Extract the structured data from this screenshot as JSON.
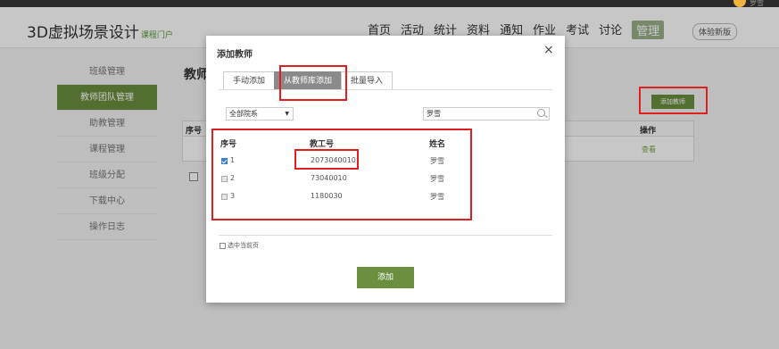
{
  "topbar": {
    "user_name": "罗雪"
  },
  "header": {
    "brand": "3D虚拟场景设计",
    "brand_sub": "课程门户",
    "nav": [
      "首页",
      "活动",
      "统计",
      "资料",
      "通知",
      "作业",
      "考试",
      "讨论",
      "管理"
    ],
    "active_nav": "管理",
    "trial_label": "体验新版"
  },
  "sidebar": {
    "items": [
      {
        "label": "班级管理",
        "active": false
      },
      {
        "label": "教师团队管理",
        "active": true
      },
      {
        "label": "助教管理",
        "active": false
      },
      {
        "label": "课程管理",
        "active": false
      },
      {
        "label": "班级分配",
        "active": false
      },
      {
        "label": "下载中心",
        "active": false
      },
      {
        "label": "操作日志",
        "active": false
      }
    ]
  },
  "background": {
    "title": "教师",
    "add_teacher": "添加教师",
    "col_seq": "序号",
    "col_op": "操作",
    "view_link": "查看"
  },
  "modal": {
    "title": "添加教师",
    "close": "×",
    "tabs": [
      "手动添加",
      "从教师库添加",
      "批量导入"
    ],
    "active_tab": 1,
    "dept_select": "全部院系",
    "search_value": "罗雪",
    "columns": {
      "seq": "序号",
      "id": "教工号",
      "name": "姓名"
    },
    "rows": [
      {
        "seq": "1",
        "id": "2073040010",
        "name": "罗雪",
        "checked": true
      },
      {
        "seq": "2",
        "id": "73040010",
        "name": "罗雪",
        "checked": false
      },
      {
        "seq": "3",
        "id": "1180030",
        "name": "罗雪",
        "checked": false
      }
    ],
    "select_page_label": "选中当前页",
    "confirm_label": "添加"
  }
}
